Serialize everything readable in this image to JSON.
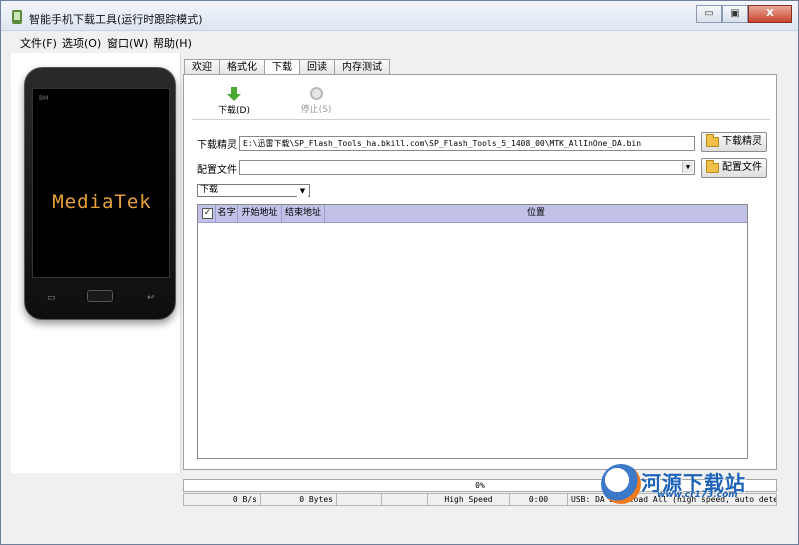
{
  "window": {
    "title": "智能手机下载工具(运行时跟踪模式)",
    "minimize": "▭",
    "restore": "▣",
    "close": "X"
  },
  "menu": [
    "文件(F)",
    "选项(O)",
    "窗口(W)",
    "帮助(H)"
  ],
  "phone": {
    "brand": "BM",
    "logo": "MediaTek",
    "left_key": "▭",
    "back_key": "↩"
  },
  "tabs": [
    "欢迎",
    "格式化",
    "下载",
    "回读",
    "内存测试"
  ],
  "active_tab": "下载",
  "toolbar": {
    "download_label": "下载(D)",
    "stop_label": "停止(S)"
  },
  "form": {
    "da_label": "下载精灵",
    "da_path": "E:\\迅雷下载\\SP_Flash_Tools_ha.bkill.com\\SP_Flash_Tools_5_1408_00\\MTK_AllInOne_DA.bin",
    "da_button": "下载精灵",
    "scatter_label": "配置文件",
    "scatter_path": "",
    "scatter_button": "配置文件",
    "mode_select": "下载"
  },
  "table": {
    "check_all": "✓",
    "columns": [
      "名字",
      "开始地址",
      "结束地址",
      "位置"
    ]
  },
  "status": {
    "progress_percent": 0,
    "progress_text": "0%",
    "speed": "0 B/s",
    "bytes": "0 Bytes",
    "blank": "",
    "mode": "High Speed",
    "time": "0:00",
    "usb": "USB: DA Download All (high speed, auto detect)"
  },
  "watermark": {
    "title": "河源下载站",
    "url": "www.cr173.com"
  },
  "colors": {
    "download_arrow": "#4aa832",
    "table_header": "#c2c2e8",
    "logo_text": "#e8a23a"
  }
}
